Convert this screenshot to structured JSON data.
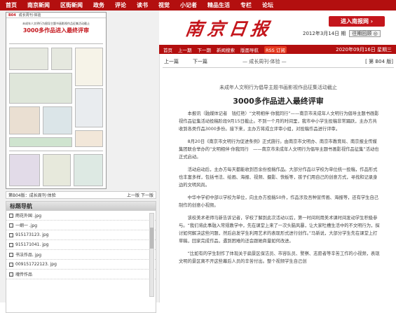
{
  "top_nav": [
    "首页",
    "南京新闻",
    "区街新闻",
    "政务",
    "评论",
    "读书",
    "视觉",
    "小记者",
    "精品生活",
    "专栏",
    "论坛"
  ],
  "header": {
    "logo": "南京日报",
    "subscribe_button": "进入南报网 ›",
    "date": "2012年3月14日 期",
    "past_button": "往期回顾 ◎"
  },
  "subnav": {
    "items": [
      "首页",
      "上一期",
      "下一期",
      "新闻搜索",
      "版面导航"
    ],
    "rss": "RSS 订阅",
    "date_text": "2020年09月16日  星期三"
  },
  "paper_thumb": {
    "page_no": "B04",
    "section": "成长周刊·体验",
    "title_small": "未成年人文明行为倡导主题书画影视作品征集活动截止",
    "title_big": "3000多作品进入最终评审"
  },
  "page_label": {
    "text": "第B04版：成长周刊·体验",
    "prev": "上一版",
    "next": "下一版"
  },
  "board_nav": {
    "title": "标题导航",
    "items": [
      "雨花外国 .jpg",
      "一纲一 .jpg",
      "915173123. jpg",
      "915171041. jpg",
      "书法作品. jpg",
      "009151722123. jpg",
      "魂传作品"
    ]
  },
  "article": {
    "prev": "上一篇",
    "next": "下一篇",
    "edition": "— 成长周刊·体验 —",
    "page": "[ 第 B04 版]",
    "suptitle": "未成年人文明行为倡导主题书画影视作品征集活动截止",
    "title": "3000多作品进入最终评审",
    "paragraphs": [
      "本报讯（融媒体记者　钱红艳）“文明相伴·你我同行”——南京市未成年人文明行为倡导主题书画影视作品征集活动投稿阶段9月15日截止。不到一个月的时间里，我市中小学生投稿非常踊跃，主办方共收到各类作品3000多份。接下来，主办方将成立评审小组，对投稿作品进行评审。",
      "8月20日《南京市文明行为促进条例》正式施行。由南京市文明办、南京市教育局、南京报业传媒集团联合举办的“文明相伴·你我同行　——南京市未成年人文明行为倡导主题书画影视作品征集”活动也正式启动。",
      "活动启动后，主办方每天都能收到百余份投稿作品。大部分作品以学校为单位统一投稿，作品形式也丰富多样，包括书法、绘画、海报、视频、摄影、快板等，孩子们用自己的创意方式，寻找和记录身边的文明风尚。",
      "中华中学初中部以学校为单位，向主办方投稿50件，作品涉及吾种宣传画、海报等，还有学生自己制作的创意小视频。",
      "该校美术老师马新告诉记者，学校了解到此次活动以后，第一时间利用美术课时间发动学生积极参与。“我们将此事融入常规教学中，先在课堂上来了一次头脑风暴，让大家吐槽生活中的不文明行为，探讨如何解决这些问题，然后启发学生利用艺术的表现形式进行创作。”马新说，大部分学生先在课堂上打草稿，回家完成作品，遇到困难的还会跟她商量如何改进。",
      "“比如有的学生制作了体现关于扁景区保洁员、市容队员、警察、志愿者等辛苦工作的小视频，表现文明的景区离不开这些幕后人员的辛苦付出。整个视频学生自己创"
    ]
  },
  "colors": {
    "brand_red": "#b30f0f",
    "logo_red": "#c4161c"
  }
}
